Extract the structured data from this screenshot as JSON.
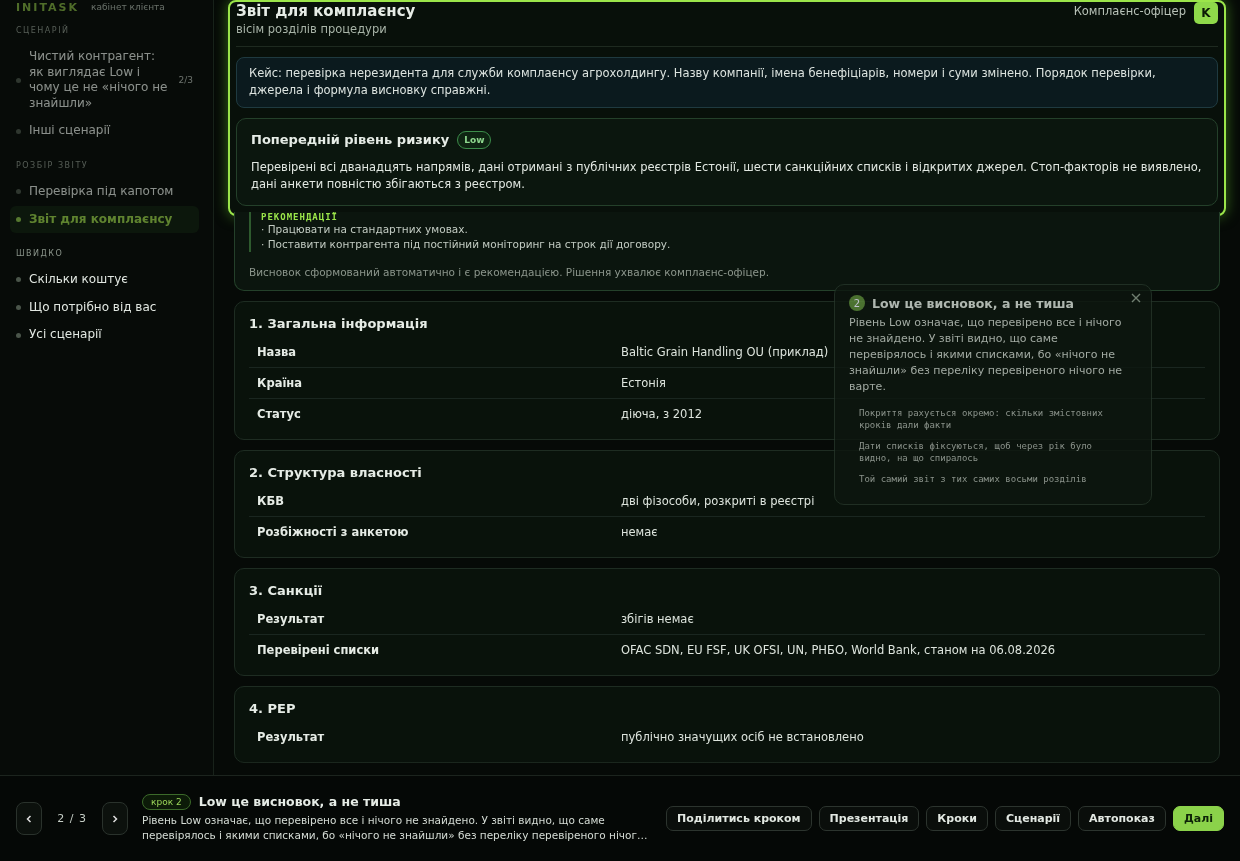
{
  "brand": {
    "logo": "INITASK",
    "subtitle": "кабінет клієнта"
  },
  "sidebar": {
    "groups": [
      {
        "title": "СЦЕНАРІЙ",
        "shaded": true,
        "items": [
          {
            "label": "Чистий контрагент: як виглядає Low і чому це не «нічого не знайшли»",
            "count": "2/3",
            "selected": false
          },
          {
            "label": "Інші сценарії",
            "selected": false
          }
        ]
      },
      {
        "title": "РОЗБІР ЗВІТУ",
        "shaded": true,
        "items": [
          {
            "label": "Перевірка під капотом",
            "selected": false
          },
          {
            "label": "Звіт для комплаєнсу",
            "selected": true
          }
        ]
      },
      {
        "title": "ШВИДКО",
        "shaded": false,
        "items": [
          {
            "label": "Скільки коштує",
            "selected": false
          },
          {
            "label": "Що потрібно від вас",
            "selected": false
          },
          {
            "label": "Усі сценарії",
            "selected": false
          }
        ]
      }
    ]
  },
  "header": {
    "title": "Звіт для комплаєнсу",
    "subtitle": "вісім розділів процедури",
    "role": "Комплаєнс-офіцер",
    "avatar": "K"
  },
  "case_note": "Кейс: перевірка нерезидента для служби комплаєнсу агрохолдингу. Назву компанії, імена бенефіціарів, номери і суми змінено. Порядок перевірки, джерела і формула висновку справжні.",
  "risk": {
    "title": "Попередній рівень ризику",
    "badge": "Low",
    "text": "Перевірені всі дванадцять напрямів, дані отримані з публічних реєстрів Естонії, шести санкційних списків і відкритих джерел. Стоп-факторів не виявлено, дані анкети повністю збігаються з реєстром.",
    "recommendations_label": "РЕКОМЕНДАЦІЇ",
    "recommendations": [
      "· Працювати на стандартних умовах.",
      "· Поставити контрагента під постійний моніторинг на строк дії договору."
    ],
    "footnote": "Висновок сформований автоматично і є рекомендацією. Рішення ухвалює комплаєнс-офіцер."
  },
  "sections": [
    {
      "title": "1. Загальна інформація",
      "rows": [
        {
          "key": "Назва",
          "value": "Baltic Grain Handling OU (приклад)"
        },
        {
          "key": "Країна",
          "value": "Естонія"
        },
        {
          "key": "Статус",
          "value": "діюча, з 2012"
        }
      ]
    },
    {
      "title": "2. Структура власності",
      "rows": [
        {
          "key": "КБВ",
          "value": "дві фізособи, розкриті в реєстрі"
        },
        {
          "key": "Розбіжності з анкетою",
          "value": "немає"
        }
      ]
    },
    {
      "title": "3. Санкції",
      "rows": [
        {
          "key": "Результат",
          "value": "збігів немає"
        },
        {
          "key": "Перевірені списки",
          "value": "OFAC SDN, EU FSF, UK OFSI, UN, РНБО, World Bank, станом на 06.08.2026"
        }
      ]
    },
    {
      "title": "4. PEP",
      "rows": [
        {
          "key": "Результат",
          "value": "публічно значущих осіб не встановлено"
        }
      ]
    }
  ],
  "popover": {
    "number": "2",
    "title": "Low це висновок, а не тиша",
    "text": "Рівень Low означає, що перевірено все і нічого не знайдено. У звіті видно, що саме перевірялось і якими списками, бо «нічого не знайшли» без переліку перевіреного нічого не варте.",
    "notes": [
      "Покриття рахується окремо: скільки змістовних кроків дали факти",
      "Дати списків фіксуються, щоб через рік було видно, на що спиралось",
      "Той самий звіт з тих самих восьми розділів"
    ]
  },
  "tour_bar": {
    "counter": "2 / 3",
    "step_badge": "крок 2",
    "title": "Low це висновок, а не тиша",
    "text": "Рівень Low означає, що перевірено все і нічого не знайдено. У звіті видно, що саме перевірялось і якими списками, бо «нічого не знайшли» без переліку перевіреного нічог…",
    "buttons": [
      {
        "label": "Поділитись кроком",
        "kind": "secondary"
      },
      {
        "label": "Презентація",
        "kind": "secondary"
      },
      {
        "label": "Кроки",
        "kind": "secondary"
      },
      {
        "label": "Сценарії",
        "kind": "secondary"
      },
      {
        "label": "Автопоказ",
        "kind": "secondary"
      },
      {
        "label": "Далі",
        "kind": "primary"
      }
    ]
  }
}
